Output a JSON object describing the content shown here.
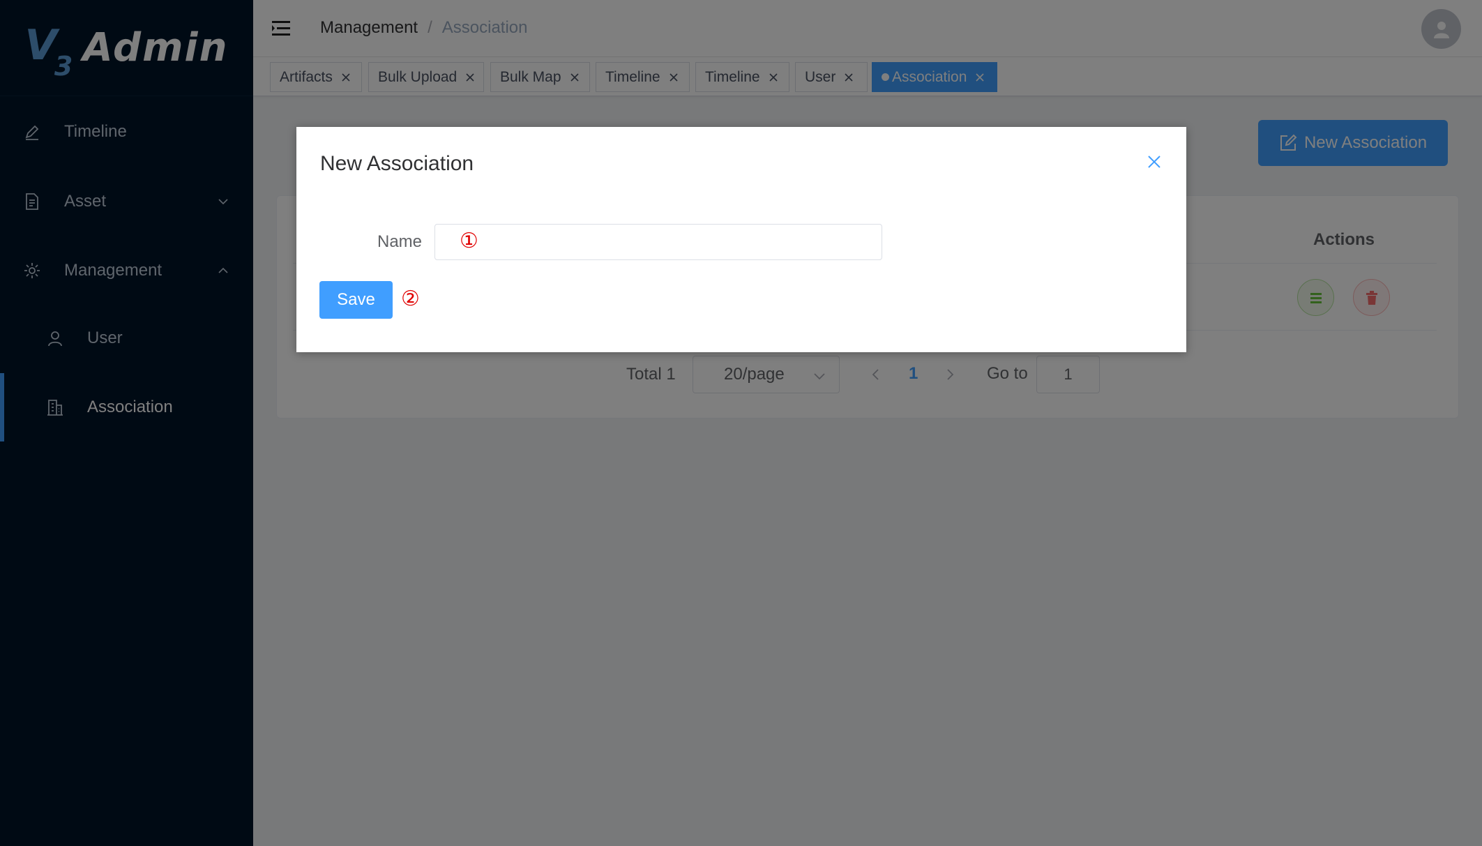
{
  "app": {
    "logo_mark": "V",
    "logo_sub": "3",
    "logo_text": "Admin"
  },
  "sidebar": {
    "items": [
      {
        "label": "Timeline",
        "icon": "edit-pen-icon"
      },
      {
        "label": "Asset",
        "icon": "document-icon",
        "expanded": false
      },
      {
        "label": "Management",
        "icon": "gear-icon",
        "expanded": true
      },
      {
        "label": "User",
        "icon": "user-icon"
      },
      {
        "label": "Association",
        "icon": "office-building-icon",
        "active": true
      }
    ]
  },
  "header": {
    "breadcrumb": [
      "Management",
      "Association"
    ],
    "separator": "/"
  },
  "tags": [
    {
      "label": "Artifacts"
    },
    {
      "label": "Bulk Upload"
    },
    {
      "label": "Bulk Map"
    },
    {
      "label": "Timeline"
    },
    {
      "label": "Timeline"
    },
    {
      "label": "User"
    },
    {
      "label": "Association",
      "active": true
    }
  ],
  "main": {
    "new_button_label": "New Association",
    "table_header_actions": "Actions",
    "pagination": {
      "total_text": "Total 1",
      "page_size": "20/page",
      "current_page": "1",
      "goto_label": "Go to",
      "goto_value": "1"
    }
  },
  "dialog": {
    "title": "New Association",
    "name_label": "Name",
    "name_value": "",
    "save_label": "Save",
    "marker_1": "①",
    "marker_2": "②"
  },
  "colors": {
    "sidebar_bg": "#001529",
    "primary": "#409eff",
    "overlay": "rgba(0,0,0,0.5)",
    "annotation": "#e00000"
  }
}
